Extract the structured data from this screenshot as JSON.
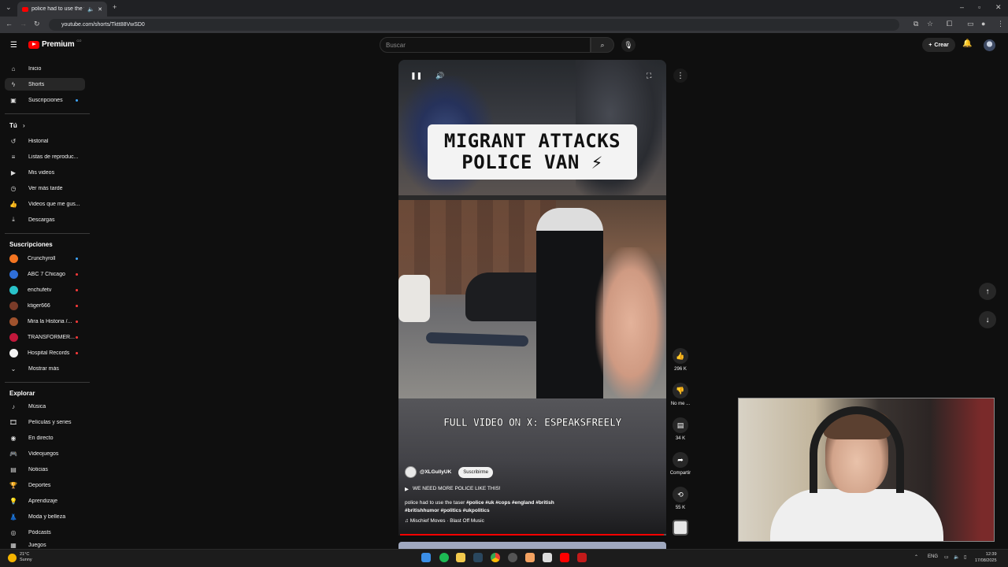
{
  "browser": {
    "tab_title": "police had to use the taser",
    "url": "youtube.com/shorts/Tktt88VwSD0"
  },
  "header": {
    "logo_text": "Premium",
    "logo_sup": "CO",
    "search_placeholder": "Buscar",
    "create_label": "Crear"
  },
  "sidebar": {
    "main": [
      {
        "label": "Inicio",
        "icon": "home-icon"
      },
      {
        "label": "Shorts",
        "icon": "shorts-icon"
      },
      {
        "label": "Suscripciones",
        "icon": "subscriptions-icon"
      }
    ],
    "you_header": "Tú",
    "you": [
      {
        "label": "Historial",
        "icon": "history-icon"
      },
      {
        "label": "Listas de reproduc...",
        "icon": "playlist-icon"
      },
      {
        "label": "Mis videos",
        "icon": "my-videos-icon"
      },
      {
        "label": "Ver más tarde",
        "icon": "watch-later-icon"
      },
      {
        "label": "Videos que me gus...",
        "icon": "liked-icon"
      },
      {
        "label": "Descargas",
        "icon": "download-icon"
      }
    ],
    "subs_header": "Suscripciones",
    "subs": [
      {
        "label": "Crunchyroll",
        "color": "#f47521"
      },
      {
        "label": "ABC 7 Chicago",
        "color": "#2f6fd8"
      },
      {
        "label": "enchufetv",
        "color": "#29c2c9"
      },
      {
        "label": "ktiger666",
        "color": "#7a3b28"
      },
      {
        "label": "Mira la Historia /...",
        "color": "#a0522d"
      },
      {
        "label": "TRANSFORMER...",
        "color": "#c2183b"
      },
      {
        "label": "Hospital Records",
        "color": "#f2f2f2"
      }
    ],
    "show_more": "Mostrar más",
    "explore_header": "Explorar",
    "explore": [
      {
        "label": "Música",
        "icon": "music-icon"
      },
      {
        "label": "Películas y series",
        "icon": "movies-icon"
      },
      {
        "label": "En directo",
        "icon": "live-icon"
      },
      {
        "label": "Videojuegos",
        "icon": "gaming-icon"
      },
      {
        "label": "Noticias",
        "icon": "news-icon"
      },
      {
        "label": "Deportes",
        "icon": "sports-icon"
      },
      {
        "label": "Aprendizaje",
        "icon": "learning-icon"
      },
      {
        "label": "Moda y belleza",
        "icon": "fashion-icon"
      },
      {
        "label": "Pódcasts",
        "icon": "podcast-icon"
      },
      {
        "label": "Juegos",
        "icon": "games-icon"
      }
    ]
  },
  "video": {
    "caption_line1": "MIGRANT ATTACKS",
    "caption_line2": "POLICE VAN ⚡",
    "overlay_text": "FULL VIDEO ON X: ESPEAKSFREELY",
    "channel": "@XLGullyUK",
    "subscribe_label": "Suscribirme",
    "description": "WE NEED MORE POLICE LIKE THIS!",
    "title_plain": "police had to use the taser",
    "title_tags_1": "#police #uk #cops #england #british",
    "title_tags_2": "#britishhumor #politics #ukpolitics",
    "music": "Mischief Moves · Blast Off Music",
    "progress_fraction": 0.99
  },
  "actions": {
    "likes": "296 K",
    "dislike_label": "No me ...",
    "comments": "34 K",
    "share_label": "Compartir",
    "remix_count": "55 K"
  },
  "taskbar": {
    "temp": "21°C",
    "weather": "Sunny",
    "lang": "ENG",
    "time": "12:39",
    "date": "17/08/2025"
  }
}
